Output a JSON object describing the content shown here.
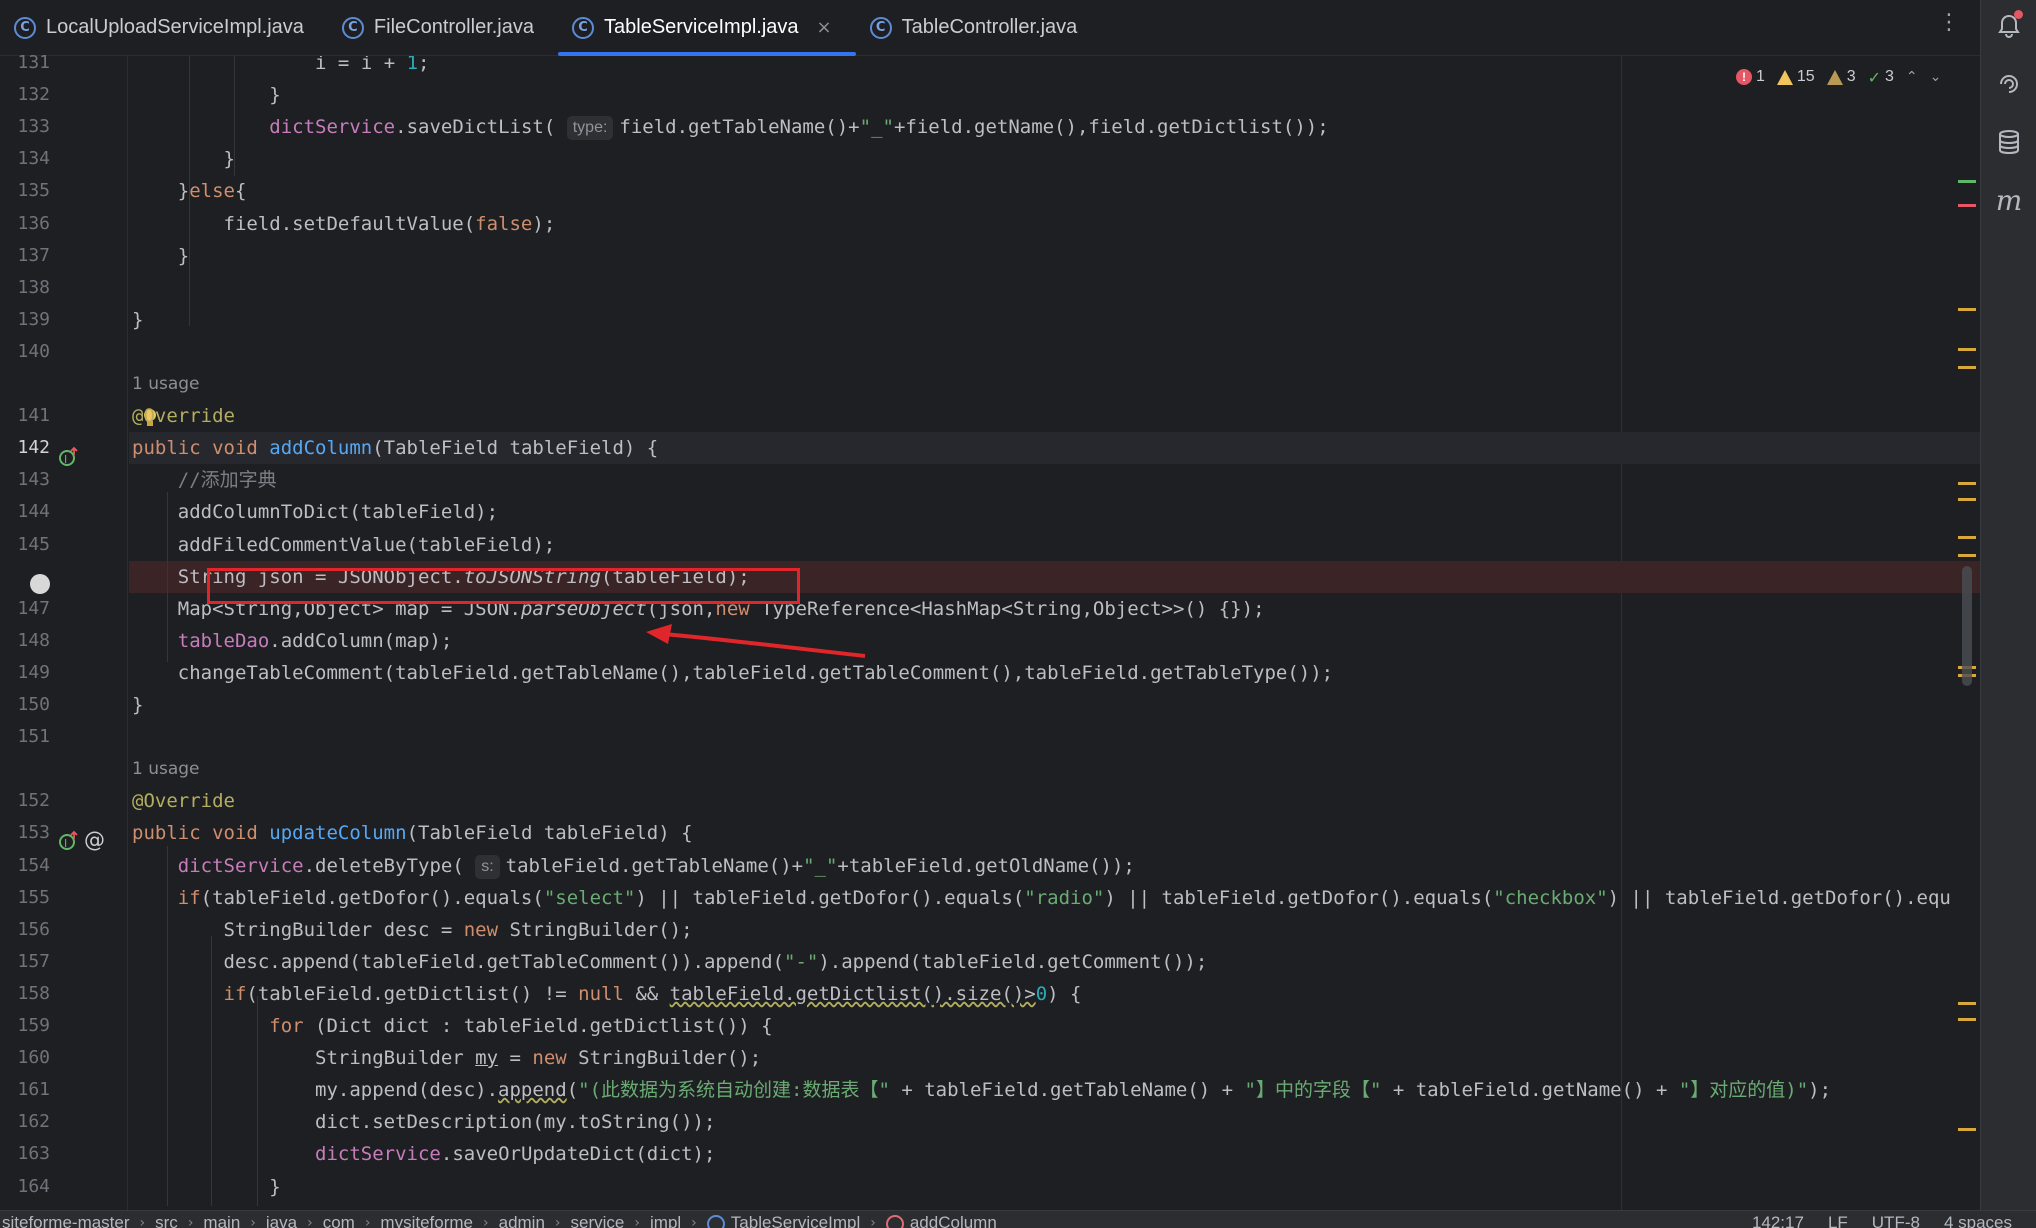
{
  "tabs": [
    {
      "label": "LocalUploadServiceImpl.java",
      "icon": "class-icon",
      "active": false
    },
    {
      "label": "FileController.java",
      "icon": "class-icon",
      "active": false
    },
    {
      "label": "TableServiceImpl.java",
      "icon": "class-icon",
      "active": true,
      "close": "×"
    },
    {
      "label": "TableController.java",
      "icon": "class-icon",
      "active": false
    }
  ],
  "tab_menu": "⋮",
  "inspections": {
    "errors": "1",
    "warnings": "15",
    "weak_warnings": "3",
    "ok": "3"
  },
  "code_lines": [
    {
      "num": "131",
      "segs": [
        [
          "",
          "                "
        ],
        [
          "",
          "i"
        ],
        [
          "",
          " = "
        ],
        [
          "",
          "i"
        ],
        [
          "",
          " + "
        ],
        [
          "num",
          "1"
        ],
        [
          "",
          ";"
        ]
      ]
    },
    {
      "num": "132",
      "segs": [
        [
          "",
          "            }"
        ]
      ]
    },
    {
      "num": "133",
      "segs": [
        [
          "",
          "            "
        ],
        [
          "fld",
          "dictService"
        ],
        [
          "",
          ".saveDictList( "
        ],
        [
          "hint",
          "type:"
        ],
        [
          "",
          "field.getTableName()+"
        ],
        [
          "str",
          "\"_\""
        ],
        [
          "",
          "+field.getName(),field.getDictlist());"
        ]
      ]
    },
    {
      "num": "134",
      "segs": [
        [
          "",
          "        }"
        ]
      ]
    },
    {
      "num": "135",
      "segs": [
        [
          "",
          "    }"
        ],
        [
          "kw",
          "else"
        ],
        [
          "",
          "{"
        ]
      ]
    },
    {
      "num": "136",
      "segs": [
        [
          "",
          "        field.setDefaultValue("
        ],
        [
          "kw",
          "false"
        ],
        [
          "",
          ");"
        ]
      ]
    },
    {
      "num": "137",
      "segs": [
        [
          "",
          "    }"
        ]
      ]
    },
    {
      "num": "138",
      "segs": []
    },
    {
      "num": "139",
      "segs": [
        [
          "",
          "}"
        ]
      ]
    },
    {
      "num": "140",
      "segs": []
    },
    {
      "num": "",
      "usage": "1 usage"
    },
    {
      "num": "141",
      "segs": [
        [
          "ann",
          "@Override"
        ]
      ]
    },
    {
      "num": "142",
      "segs": [
        [
          "kw",
          "public void "
        ],
        [
          "fn",
          "addColumn"
        ],
        [
          "",
          "(TableField tableField) {"
        ]
      ],
      "current": true
    },
    {
      "num": "143",
      "segs": [
        [
          "cmt",
          "    //添加字典"
        ]
      ]
    },
    {
      "num": "144",
      "segs": [
        [
          "",
          "    addColumnToDict(tableField);"
        ]
      ]
    },
    {
      "num": "145",
      "segs": [
        [
          "",
          "    addFiledCommentValue(tableField);"
        ]
      ]
    },
    {
      "num": "",
      "segs": [
        [
          "",
          "    String json = JSONObject."
        ],
        [
          "it",
          "toJSONString"
        ],
        [
          "",
          "(tableField);"
        ]
      ],
      "breakpoint": true
    },
    {
      "num": "147",
      "segs": [
        [
          "",
          "    Map<String,Object> map = JSON."
        ],
        [
          "it",
          "parseObject"
        ],
        [
          "",
          "(json,"
        ],
        [
          "kw",
          "new "
        ],
        [
          "",
          "TypeReference<HashMap<String,Object>>() {});"
        ]
      ]
    },
    {
      "num": "148",
      "segs": [
        [
          "",
          "    "
        ],
        [
          "fld",
          "tableDao"
        ],
        [
          "",
          ".addColumn(map);"
        ]
      ]
    },
    {
      "num": "149",
      "segs": [
        [
          "",
          "    changeTableComment(tableField.getTableName(),tableField.getTableComment(),tableField.getTableType());"
        ]
      ]
    },
    {
      "num": "150",
      "segs": [
        [
          "",
          "}"
        ]
      ]
    },
    {
      "num": "151",
      "segs": []
    },
    {
      "num": "",
      "usage": "1 usage"
    },
    {
      "num": "152",
      "segs": [
        [
          "ann",
          "@Override"
        ]
      ]
    },
    {
      "num": "153",
      "segs": [
        [
          "kw",
          "public void "
        ],
        [
          "fn",
          "updateColumn"
        ],
        [
          "",
          "(TableField tableField) {"
        ]
      ]
    },
    {
      "num": "154",
      "segs": [
        [
          "",
          "    "
        ],
        [
          "fld",
          "dictService"
        ],
        [
          "",
          ".deleteByType( "
        ],
        [
          "hint",
          "s:"
        ],
        [
          "",
          "tableField.getTableName()+"
        ],
        [
          "str",
          "\"_\""
        ],
        [
          "",
          "+tableField.getOldName());"
        ]
      ]
    },
    {
      "num": "155",
      "segs": [
        [
          "kw",
          "    if"
        ],
        [
          "",
          "(tableField.getDofor().equals("
        ],
        [
          "str",
          "\"select\""
        ],
        [
          "",
          ") || tableField.getDofor().equals("
        ],
        [
          "str",
          "\"radio\""
        ],
        [
          "",
          ") || tableField.getDofor().equals("
        ],
        [
          "str",
          "\"checkbox\""
        ],
        [
          "",
          ") || tableField.getDofor().equ"
        ]
      ]
    },
    {
      "num": "156",
      "segs": [
        [
          "",
          "        StringBuilder desc = "
        ],
        [
          "kw",
          "new "
        ],
        [
          "",
          "StringBuilder();"
        ]
      ]
    },
    {
      "num": "157",
      "segs": [
        [
          "",
          "        desc.append(tableField.getTableComment()).append("
        ],
        [
          "str",
          "\"-\""
        ],
        [
          "",
          ").append(tableField.getComment());"
        ]
      ]
    },
    {
      "num": "158",
      "segs": [
        [
          "kw",
          "        if"
        ],
        [
          "",
          "(tableField.getDictlist() != "
        ],
        [
          "kw",
          "null"
        ],
        [
          "",
          " && "
        ],
        [
          "wav",
          "tableField.getDictlist().size()>"
        ],
        [
          "num",
          "0"
        ],
        [
          "",
          ") {"
        ]
      ]
    },
    {
      "num": "159",
      "segs": [
        [
          "kw",
          "            for "
        ],
        [
          "",
          "(Dict dict : tableField.getDictlist()) {"
        ]
      ]
    },
    {
      "num": "160",
      "segs": [
        [
          "",
          "                StringBuilder "
        ],
        [
          "ul",
          "my"
        ],
        [
          "",
          " = "
        ],
        [
          "kw",
          "new "
        ],
        [
          "",
          "StringBuilder();"
        ]
      ]
    },
    {
      "num": "161",
      "segs": [
        [
          "",
          "                my.append(desc)."
        ],
        [
          "wav",
          "append"
        ],
        [
          "",
          "("
        ],
        [
          "str",
          "\"(此数据为系统自动创建:数据表【\""
        ],
        [
          "",
          " + tableField.getTableName() + "
        ],
        [
          "str",
          "\"】中的字段【\""
        ],
        [
          "",
          " + tableField.getName() + "
        ],
        [
          "str",
          "\"】对应的值)\""
        ],
        [
          "",
          ");"
        ]
      ]
    },
    {
      "num": "162",
      "segs": [
        [
          "",
          "                dict.setDescription(my.toString());"
        ]
      ]
    },
    {
      "num": "163",
      "segs": [
        [
          "",
          "                "
        ],
        [
          "fld",
          "dictService"
        ],
        [
          "",
          ".saveOrUpdateDict(dict);"
        ]
      ]
    },
    {
      "num": "164",
      "segs": [
        [
          "",
          "            }"
        ]
      ]
    }
  ],
  "breadcrumbs": [
    "siteforme-master",
    "src",
    "main",
    "java",
    "com",
    "mysiteforme",
    "admin",
    "service",
    "impl",
    "TableServiceImpl",
    "addColumn"
  ],
  "status": {
    "position": "142:17",
    "line_sep": "LF",
    "encoding": "UTF-8",
    "indent": "4 spaces"
  },
  "colors": {
    "accent": "#3574f0",
    "error": "#e55765",
    "warning": "#f2c55c",
    "annotation_red": "#e0262b"
  }
}
